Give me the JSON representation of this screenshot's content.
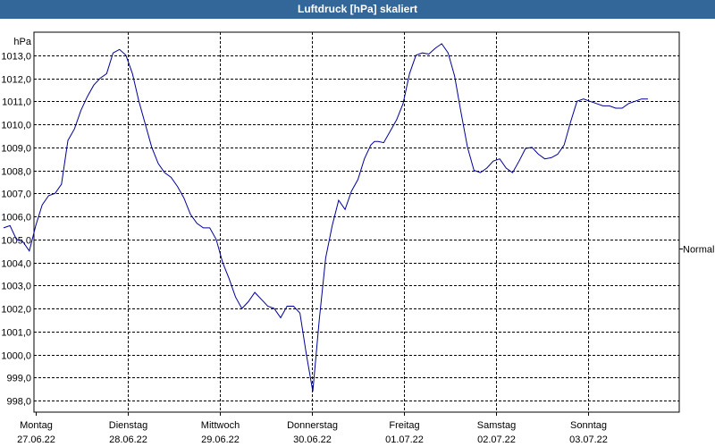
{
  "window": {
    "title": "Luftdruck [hPa] skaliert"
  },
  "colors": {
    "title_bg": "#336699",
    "series_line": "#000099",
    "grid": "#000000",
    "normal_marker": "#000000"
  },
  "chart_data": {
    "type": "line",
    "title": "Luftdruck [hPa] skaliert",
    "unit_label": "hPa",
    "ylim": [
      997.5,
      1014.0
    ],
    "yticks": [
      "998,0",
      "999,0",
      "1000,0",
      "1001,0",
      "1002,0",
      "1003,0",
      "1004,0",
      "1005,0",
      "1006,0",
      "1007,0",
      "1008,0",
      "1009,0",
      "1010,0",
      "1011,0",
      "1012,0",
      "1013,0"
    ],
    "ytick_values": [
      998,
      999,
      1000,
      1001,
      1002,
      1003,
      1004,
      1005,
      1006,
      1007,
      1008,
      1009,
      1010,
      1011,
      1012,
      1013
    ],
    "xlim": [
      -0.35,
      6.65
    ],
    "day_ticks": [
      {
        "day": "Montag",
        "date": "27.06.22"
      },
      {
        "day": "Dienstag",
        "date": "28.06.22"
      },
      {
        "day": "Mittwoch",
        "date": "29.06.22"
      },
      {
        "day": "Donnerstag",
        "date": "30.06.22"
      },
      {
        "day": "Freitag",
        "date": "01.07.22"
      },
      {
        "day": "Samstag",
        "date": "02.07.22"
      },
      {
        "day": "Sonntag",
        "date": "03.07.22"
      }
    ],
    "normal_label": "Normal",
    "normal_value": 1004.6,
    "grid": true,
    "series": [
      {
        "x": [
          -0.35,
          -0.28,
          -0.21,
          -0.14,
          -0.07,
          0.0,
          0.07,
          0.14,
          0.21,
          0.28,
          0.35,
          0.42,
          0.49,
          0.56,
          0.63,
          0.7,
          0.77,
          0.84,
          0.91,
          0.98,
          1.05,
          1.12,
          1.19,
          1.26,
          1.33,
          1.4,
          1.47,
          1.54,
          1.61,
          1.68,
          1.75,
          1.82,
          1.89,
          1.96,
          2.03,
          2.1,
          2.17,
          2.24,
          2.31,
          2.38,
          2.45,
          2.52,
          2.59,
          2.66,
          2.73,
          2.8,
          2.87,
          2.94,
          3.01,
          3.08,
          3.15,
          3.22,
          3.29,
          3.36,
          3.43,
          3.5,
          3.57,
          3.64,
          3.68,
          3.72,
          3.78,
          3.85,
          3.92,
          3.99,
          4.06,
          4.13,
          4.2,
          4.27,
          4.34,
          4.41,
          4.48,
          4.55,
          4.62,
          4.69,
          4.76,
          4.83,
          4.9,
          4.97,
          5.04,
          5.11,
          5.18,
          5.25,
          5.32,
          5.39,
          5.46,
          5.53,
          5.6,
          5.67,
          5.74,
          5.81,
          5.88,
          5.95,
          6.02,
          6.09,
          6.16,
          6.23,
          6.3,
          6.37,
          6.44,
          6.51,
          6.58,
          6.65
        ],
        "values": [
          1005.5,
          1005.6,
          1005.0,
          1004.9,
          1004.5,
          1005.6,
          1006.5,
          1006.9,
          1007.0,
          1007.4,
          1009.3,
          1009.8,
          1010.6,
          1011.2,
          1011.7,
          1012.0,
          1012.2,
          1013.1,
          1013.25,
          1013.0,
          1012.2,
          1011.0,
          1010.0,
          1009.0,
          1008.3,
          1007.9,
          1007.7,
          1007.3,
          1006.8,
          1006.1,
          1005.7,
          1005.5,
          1005.5,
          1005.0,
          1004.0,
          1003.3,
          1002.5,
          1002.0,
          1002.3,
          1002.7,
          1002.4,
          1002.1,
          1002.0,
          1001.6,
          1002.1,
          1002.1,
          1001.8,
          1000.0,
          998.4,
          1001.5,
          1004.2,
          1005.6,
          1006.7,
          1006.3,
          1007.1,
          1007.6,
          1008.5,
          1009.1,
          1009.25,
          1009.25,
          1009.2,
          1009.7,
          1010.2,
          1010.9,
          1012.2,
          1013.0,
          1013.1,
          1013.05,
          1013.3,
          1013.5,
          1013.1,
          1012.1,
          1010.5,
          1009.0,
          1008.0,
          1007.9,
          1008.1,
          1008.4,
          1008.5,
          1008.1,
          1007.9,
          1008.4,
          1008.95,
          1009.0,
          1008.7,
          1008.5,
          1008.55,
          1008.7,
          1009.1,
          1010.1,
          1011.0,
          1011.1,
          1011.0,
          1010.9,
          1010.8,
          1010.8,
          1010.7,
          1010.7,
          1010.9,
          1011.0,
          1011.1,
          1011.1
        ]
      }
    ]
  }
}
